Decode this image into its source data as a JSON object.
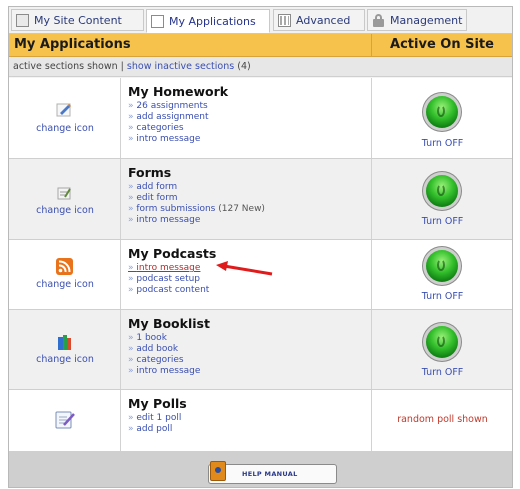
{
  "tabs": [
    {
      "label": "My Site Content",
      "icon": "site-content-icon",
      "active": false
    },
    {
      "label": "My Applications",
      "icon": "page-icon",
      "active": true
    },
    {
      "label": "Advanced",
      "icon": "advanced-grid-icon",
      "active": false
    },
    {
      "label": "Management",
      "icon": "lock-icon",
      "active": false
    }
  ],
  "header": {
    "title": "My Applications",
    "status_col": "Active On Site"
  },
  "subbar": {
    "prefix": "active sections shown",
    "separator": " | ",
    "link": "show inactive sections",
    "count": "(4)"
  },
  "apps": [
    {
      "title": "My Homework",
      "icon": "homework-pencil-icon",
      "change_label": "change icon",
      "links": [
        {
          "text": "26 assignments"
        },
        {
          "text": "add assignment"
        },
        {
          "text": "categories"
        },
        {
          "text": "intro message"
        }
      ],
      "status": {
        "type": "toggle",
        "label": "Turn OFF"
      }
    },
    {
      "title": "Forms",
      "icon": "forms-icon",
      "change_label": "change icon",
      "links": [
        {
          "text": "add form"
        },
        {
          "text": "edit form"
        },
        {
          "text": "form submissions",
          "note": "(127 New)"
        },
        {
          "text": "intro message"
        }
      ],
      "status": {
        "type": "toggle",
        "label": "Turn OFF"
      }
    },
    {
      "title": "My Podcasts",
      "icon": "rss-icon",
      "change_label": "change icon",
      "links": [
        {
          "text": "intro message",
          "highlight": true
        },
        {
          "text": "podcast setup"
        },
        {
          "text": "podcast content"
        }
      ],
      "status": {
        "type": "toggle",
        "label": "Turn OFF"
      }
    },
    {
      "title": "My Booklist",
      "icon": "books-icon",
      "change_label": "change icon",
      "links": [
        {
          "text": "1 book"
        },
        {
          "text": "add book"
        },
        {
          "text": "categories"
        },
        {
          "text": "intro message"
        }
      ],
      "status": {
        "type": "toggle",
        "label": "Turn OFF"
      }
    },
    {
      "title": "My Polls",
      "icon": "poll-checklist-icon",
      "change_label": "",
      "links": [
        {
          "text": "edit 1 poll"
        },
        {
          "text": "add poll"
        }
      ],
      "status": {
        "type": "text",
        "label": "random poll shown"
      }
    }
  ],
  "footer": {
    "help_label": "HELP MANUAL"
  },
  "colors": {
    "header_bg": "#f6c24b",
    "link": "#3a4fb2",
    "accent_red": "#c0392b",
    "toggle_green": "#34c02c"
  }
}
